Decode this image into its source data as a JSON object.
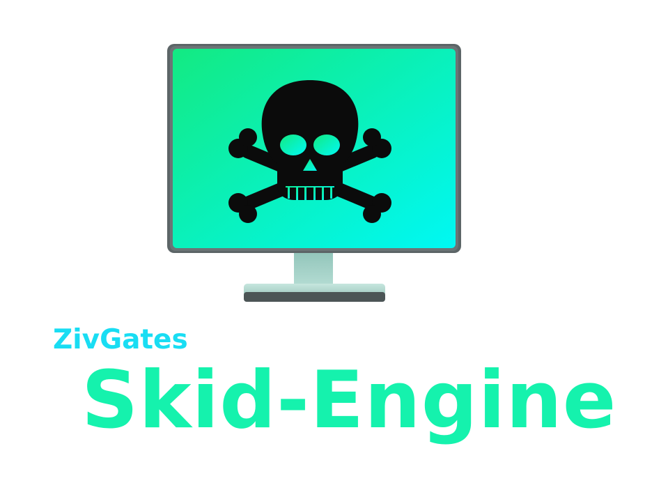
{
  "brand": {
    "small_text": "ZivGates",
    "large_text": "Skid-Engine",
    "small_color": "#19ddf3",
    "large_color": "#15f2ad"
  },
  "icon": {
    "name": "skull-crossbones-monitor-icon",
    "screen_gradient_start": "#13ea82",
    "screen_gradient_end": "#00f8f4",
    "bezel_color": "#5a6264",
    "stand_color": "#9ecdc3",
    "base_color": "#b6ddd3",
    "skull_color": "#0b0b0b"
  }
}
